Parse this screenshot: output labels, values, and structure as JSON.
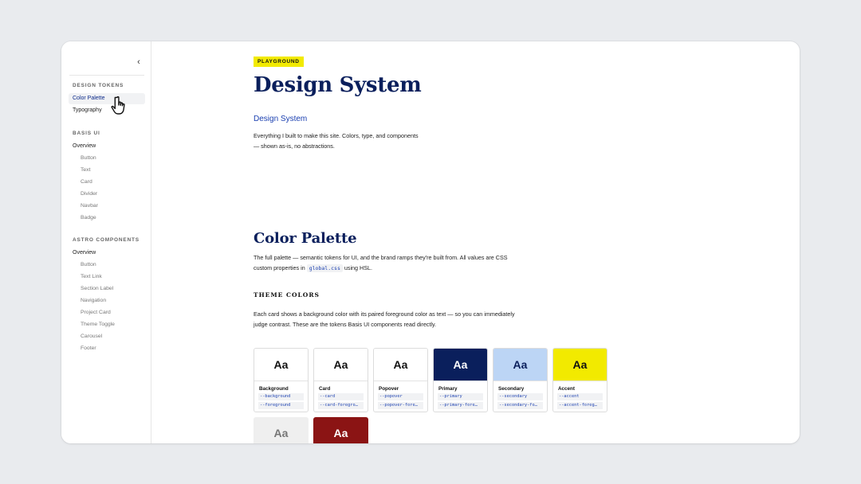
{
  "sidebar": {
    "collapse_label": "‹",
    "sections": [
      {
        "title": "DESIGN TOKENS"
      },
      {
        "title": "BASIS UI"
      },
      {
        "title": "ASTRO COMPONENTS"
      }
    ],
    "design_tokens": [
      "Color Palette",
      "Typography"
    ],
    "basis_overview": "Overview",
    "basis_items": [
      "Button",
      "Text",
      "Card",
      "Divider",
      "Navbar",
      "Badge"
    ],
    "astro_overview": "Overview",
    "astro_items": [
      "Button",
      "Text Link",
      "Section Label",
      "Navigation",
      "Project Card",
      "Theme Toggle",
      "Carousel",
      "Footer"
    ]
  },
  "main": {
    "tag": "PLAYGROUND",
    "title": "Design System",
    "subtitle_link": "Design System",
    "intro": "Everything I built to make this site. Colors, type, and components — shown as-is, no abstractions.",
    "palette_title": "Color Palette",
    "palette_text_before": "The full palette — semantic tokens for UI, and the brand ramps they're built from. All values are CSS custom properties in ",
    "palette_code": "global.css",
    "palette_text_after": " using HSL.",
    "theme_heading": "THEME COLORS",
    "theme_text": "Each card shows a background color with its paired foreground color as text — so you can immediately judge contrast. These are the tokens Basis UI components read directly."
  },
  "cards": [
    {
      "sample": "Aa",
      "name": "Background",
      "tokens": [
        "--background",
        "--foreground"
      ],
      "bg": "#ffffff",
      "fg": "#111111"
    },
    {
      "sample": "Aa",
      "name": "Card",
      "tokens": [
        "--card",
        "--card-foregro…"
      ],
      "bg": "#ffffff",
      "fg": "#111111"
    },
    {
      "sample": "Aa",
      "name": "Popover",
      "tokens": [
        "--popover",
        "--popover-fore…"
      ],
      "bg": "#ffffff",
      "fg": "#111111"
    },
    {
      "sample": "Aa",
      "name": "Primary",
      "tokens": [
        "--primary",
        "--primary-fore…"
      ],
      "bg": "#0a1f5c",
      "fg": "#ffffff"
    },
    {
      "sample": "Aa",
      "name": "Secondary",
      "tokens": [
        "--secondary",
        "--secondary-fo…"
      ],
      "bg": "#bcd5f5",
      "fg": "#0a1f5c"
    },
    {
      "sample": "Aa",
      "name": "Accent",
      "tokens": [
        "--accent",
        "--accent-foreg…"
      ],
      "bg": "#f2ea00",
      "fg": "#111111"
    },
    {
      "sample": "Aa",
      "name": "",
      "tokens": [],
      "bg": "#efefef",
      "fg": "#777777"
    },
    {
      "sample": "Aa",
      "name": "",
      "tokens": [],
      "bg": "#8b1414",
      "fg": "#ffffff"
    }
  ],
  "colors": {
    "brand_navy": "#0a1f5c",
    "link_blue": "#1a3fb0",
    "highlight_yellow": "#f2ea00"
  },
  "icons": {
    "collapse": "chevron-left-icon",
    "cursor": "hand-pointer-icon"
  }
}
